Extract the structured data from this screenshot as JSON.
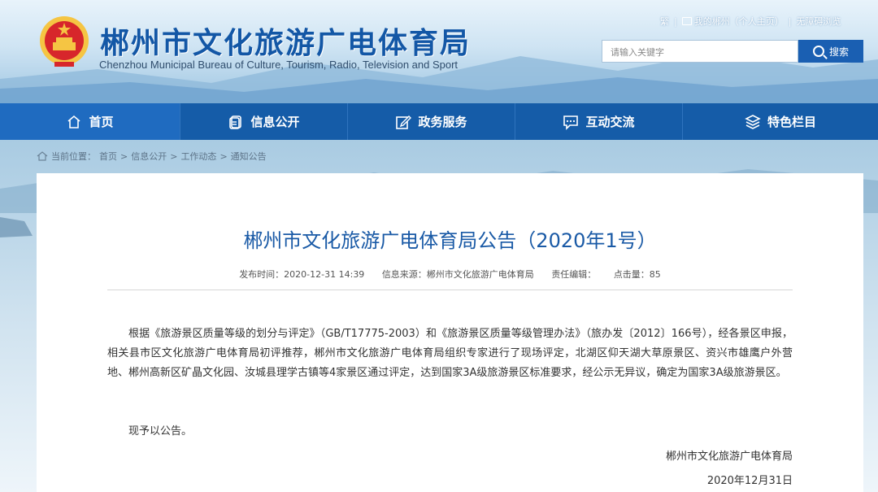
{
  "header": {
    "title": "郴州市文化旅游广电体育局",
    "subtitle": "Chenzhou Municipal Bureau of Culture, Tourism, Radio, Television and Sport",
    "toplinks": {
      "traditional": "繁",
      "my_site": "我的郴州（个人主页）",
      "accessibility": "无障碍浏览"
    },
    "search": {
      "placeholder": "请输入关键字",
      "button_label": "搜索"
    }
  },
  "nav": {
    "items": [
      {
        "label": "首页",
        "icon": "home-icon"
      },
      {
        "label": "信息公开",
        "icon": "document-icon"
      },
      {
        "label": "政务服务",
        "icon": "edit-icon"
      },
      {
        "label": "互动交流",
        "icon": "chat-icon"
      },
      {
        "label": "特色栏目",
        "icon": "layers-icon"
      }
    ]
  },
  "breadcrumb": {
    "prefix": "当前位置：",
    "items": [
      "首页",
      "信息公开",
      "工作动态",
      "通知公告"
    ],
    "separator": ">"
  },
  "article": {
    "title": "郴州市文化旅游广电体育局公告（2020年1号）",
    "publish_time": "发布时间：2020-12-31 14:39",
    "source": "信息来源：郴州市文化旅游广电体育局",
    "editor": "责任编辑：",
    "views": "点击量：85",
    "body": "根据《旅游景区质量等级的划分与评定》（GB/T17775-2003）和《旅游景区质量等级管理办法》（旅办发〔2012〕166号），经各景区申报，相关县市区文化旅游广电体育局初评推荐，郴州市文化旅游广电体育局组织专家进行了现场评定，北湖区仰天湖大草原景区、资兴市雄鹰户外营地、郴州高新区矿晶文化园、汝城县理学古镇等4家景区通过评定，达到国家3A级旅游景区标准要求，经公示无异议，确定为国家3A级旅游景区。",
    "notice": "现予以公告。",
    "signature_org": "郴州市文化旅游广电体育局",
    "signature_date": "2020年12月31日"
  },
  "colors": {
    "primary": "#155ca8",
    "title_blue": "#1a5aa6",
    "emblem_red": "#d7262b",
    "emblem_gold": "#f5c543"
  }
}
